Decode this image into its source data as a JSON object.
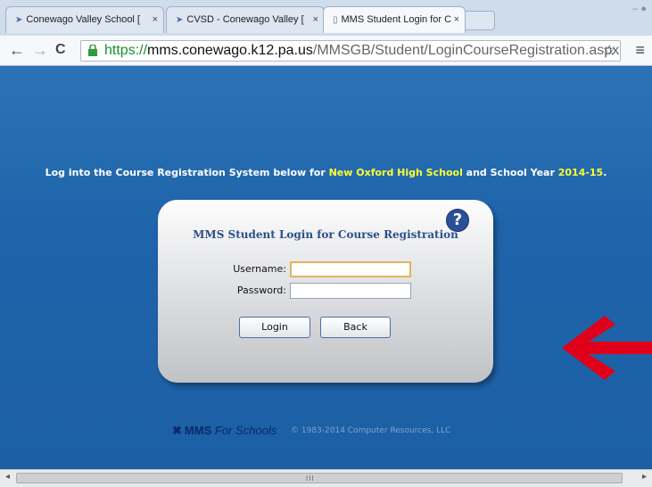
{
  "browser": {
    "tabs": [
      {
        "title": "Conewago Valley School [",
        "favicon": "eagle-icon",
        "active": false
      },
      {
        "title": "CVSD - Conewago Valley [",
        "favicon": "eagle-icon",
        "active": false
      },
      {
        "title": "MMS Student Login for C",
        "favicon": "page-icon",
        "active": true
      }
    ],
    "close_glyph": "×",
    "url": {
      "scheme": "https://",
      "host": "mms.conewago.k12.pa.us",
      "path": "/MMSGB/Student/LoginCourseRegistration.aspx?xreturnu"
    }
  },
  "page": {
    "intro": {
      "prefix": "Log into the Course Registration System below for ",
      "school": "New Oxford High School",
      "middle": " and School Year ",
      "year": "2014-15",
      "suffix": "."
    },
    "login": {
      "title": "MMS Student Login for Course Registration",
      "help_symbol": "?",
      "username_label": "Username:",
      "password_label": "Password:",
      "username_value": "",
      "password_value": "",
      "login_label": "Login",
      "back_label": "Back"
    },
    "footer": {
      "brand": "MMS",
      "brand_sub": "For Schools",
      "copyright": "© 1983-2014 Computer Resources, LLC"
    }
  },
  "colors": {
    "page_bg": "#1f64aa",
    "highlight": "#ffff33",
    "title_blue": "#2b4f8a",
    "arrow_red": "#e0001a"
  },
  "scrollbar": {
    "grip": "III"
  }
}
